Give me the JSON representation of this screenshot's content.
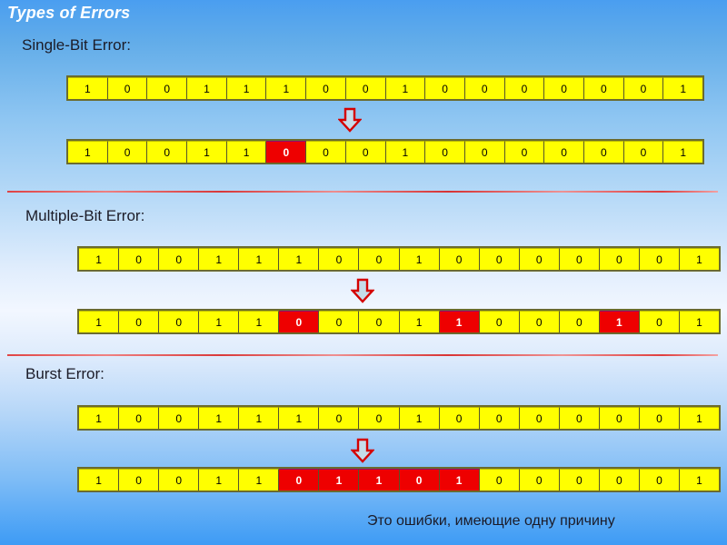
{
  "slide": {
    "title": "Types of Errors",
    "footnote": "Это ошибки, имеющие одну причину",
    "background_top_color": "#4a9ef0",
    "background_mid_color": "#f2f7ff",
    "background_bottom_color": "#3d9bf5",
    "title_color": "#ffffff",
    "divider_color": "#e03b3b",
    "cell_normal_color": "#ffff00",
    "cell_error_color": "#ee0000",
    "arrow_fill_color": "#c5dcea",
    "arrow_stroke_color": "#d40000"
  },
  "sections": [
    {
      "label": "Single-Bit Error:",
      "arrow_icon": "down-arrow-icon",
      "rows": [
        {
          "name": "sent-frame",
          "bits": [
            "1",
            "0",
            "0",
            "1",
            "1",
            "1",
            "0",
            "0",
            "1",
            "0",
            "0",
            "0",
            "0",
            "0",
            "0",
            "1"
          ],
          "errors": []
        },
        {
          "name": "received-frame",
          "bits": [
            "1",
            "0",
            "0",
            "1",
            "1",
            "0",
            "0",
            "0",
            "1",
            "0",
            "0",
            "0",
            "0",
            "0",
            "0",
            "1"
          ],
          "errors": [
            5
          ]
        }
      ]
    },
    {
      "label": "Multiple-Bit Error:",
      "arrow_icon": "down-arrow-icon",
      "rows": [
        {
          "name": "sent-frame",
          "bits": [
            "1",
            "0",
            "0",
            "1",
            "1",
            "1",
            "0",
            "0",
            "1",
            "0",
            "0",
            "0",
            "0",
            "0",
            "0",
            "1"
          ],
          "errors": []
        },
        {
          "name": "received-frame",
          "bits": [
            "1",
            "0",
            "0",
            "1",
            "1",
            "0",
            "0",
            "0",
            "1",
            "1",
            "0",
            "0",
            "0",
            "1",
            "0",
            "1"
          ],
          "errors": [
            5,
            9,
            13
          ]
        }
      ]
    },
    {
      "label": "Burst Error:",
      "arrow_icon": "down-arrow-icon",
      "rows": [
        {
          "name": "sent-frame",
          "bits": [
            "1",
            "0",
            "0",
            "1",
            "1",
            "1",
            "0",
            "0",
            "1",
            "0",
            "0",
            "0",
            "0",
            "0",
            "0",
            "1"
          ],
          "errors": []
        },
        {
          "name": "received-frame",
          "bits": [
            "1",
            "0",
            "0",
            "1",
            "1",
            "0",
            "1",
            "1",
            "0",
            "1",
            "0",
            "0",
            "0",
            "0",
            "0",
            "1"
          ],
          "errors": [
            5,
            6,
            7,
            8,
            9
          ]
        }
      ]
    }
  ]
}
